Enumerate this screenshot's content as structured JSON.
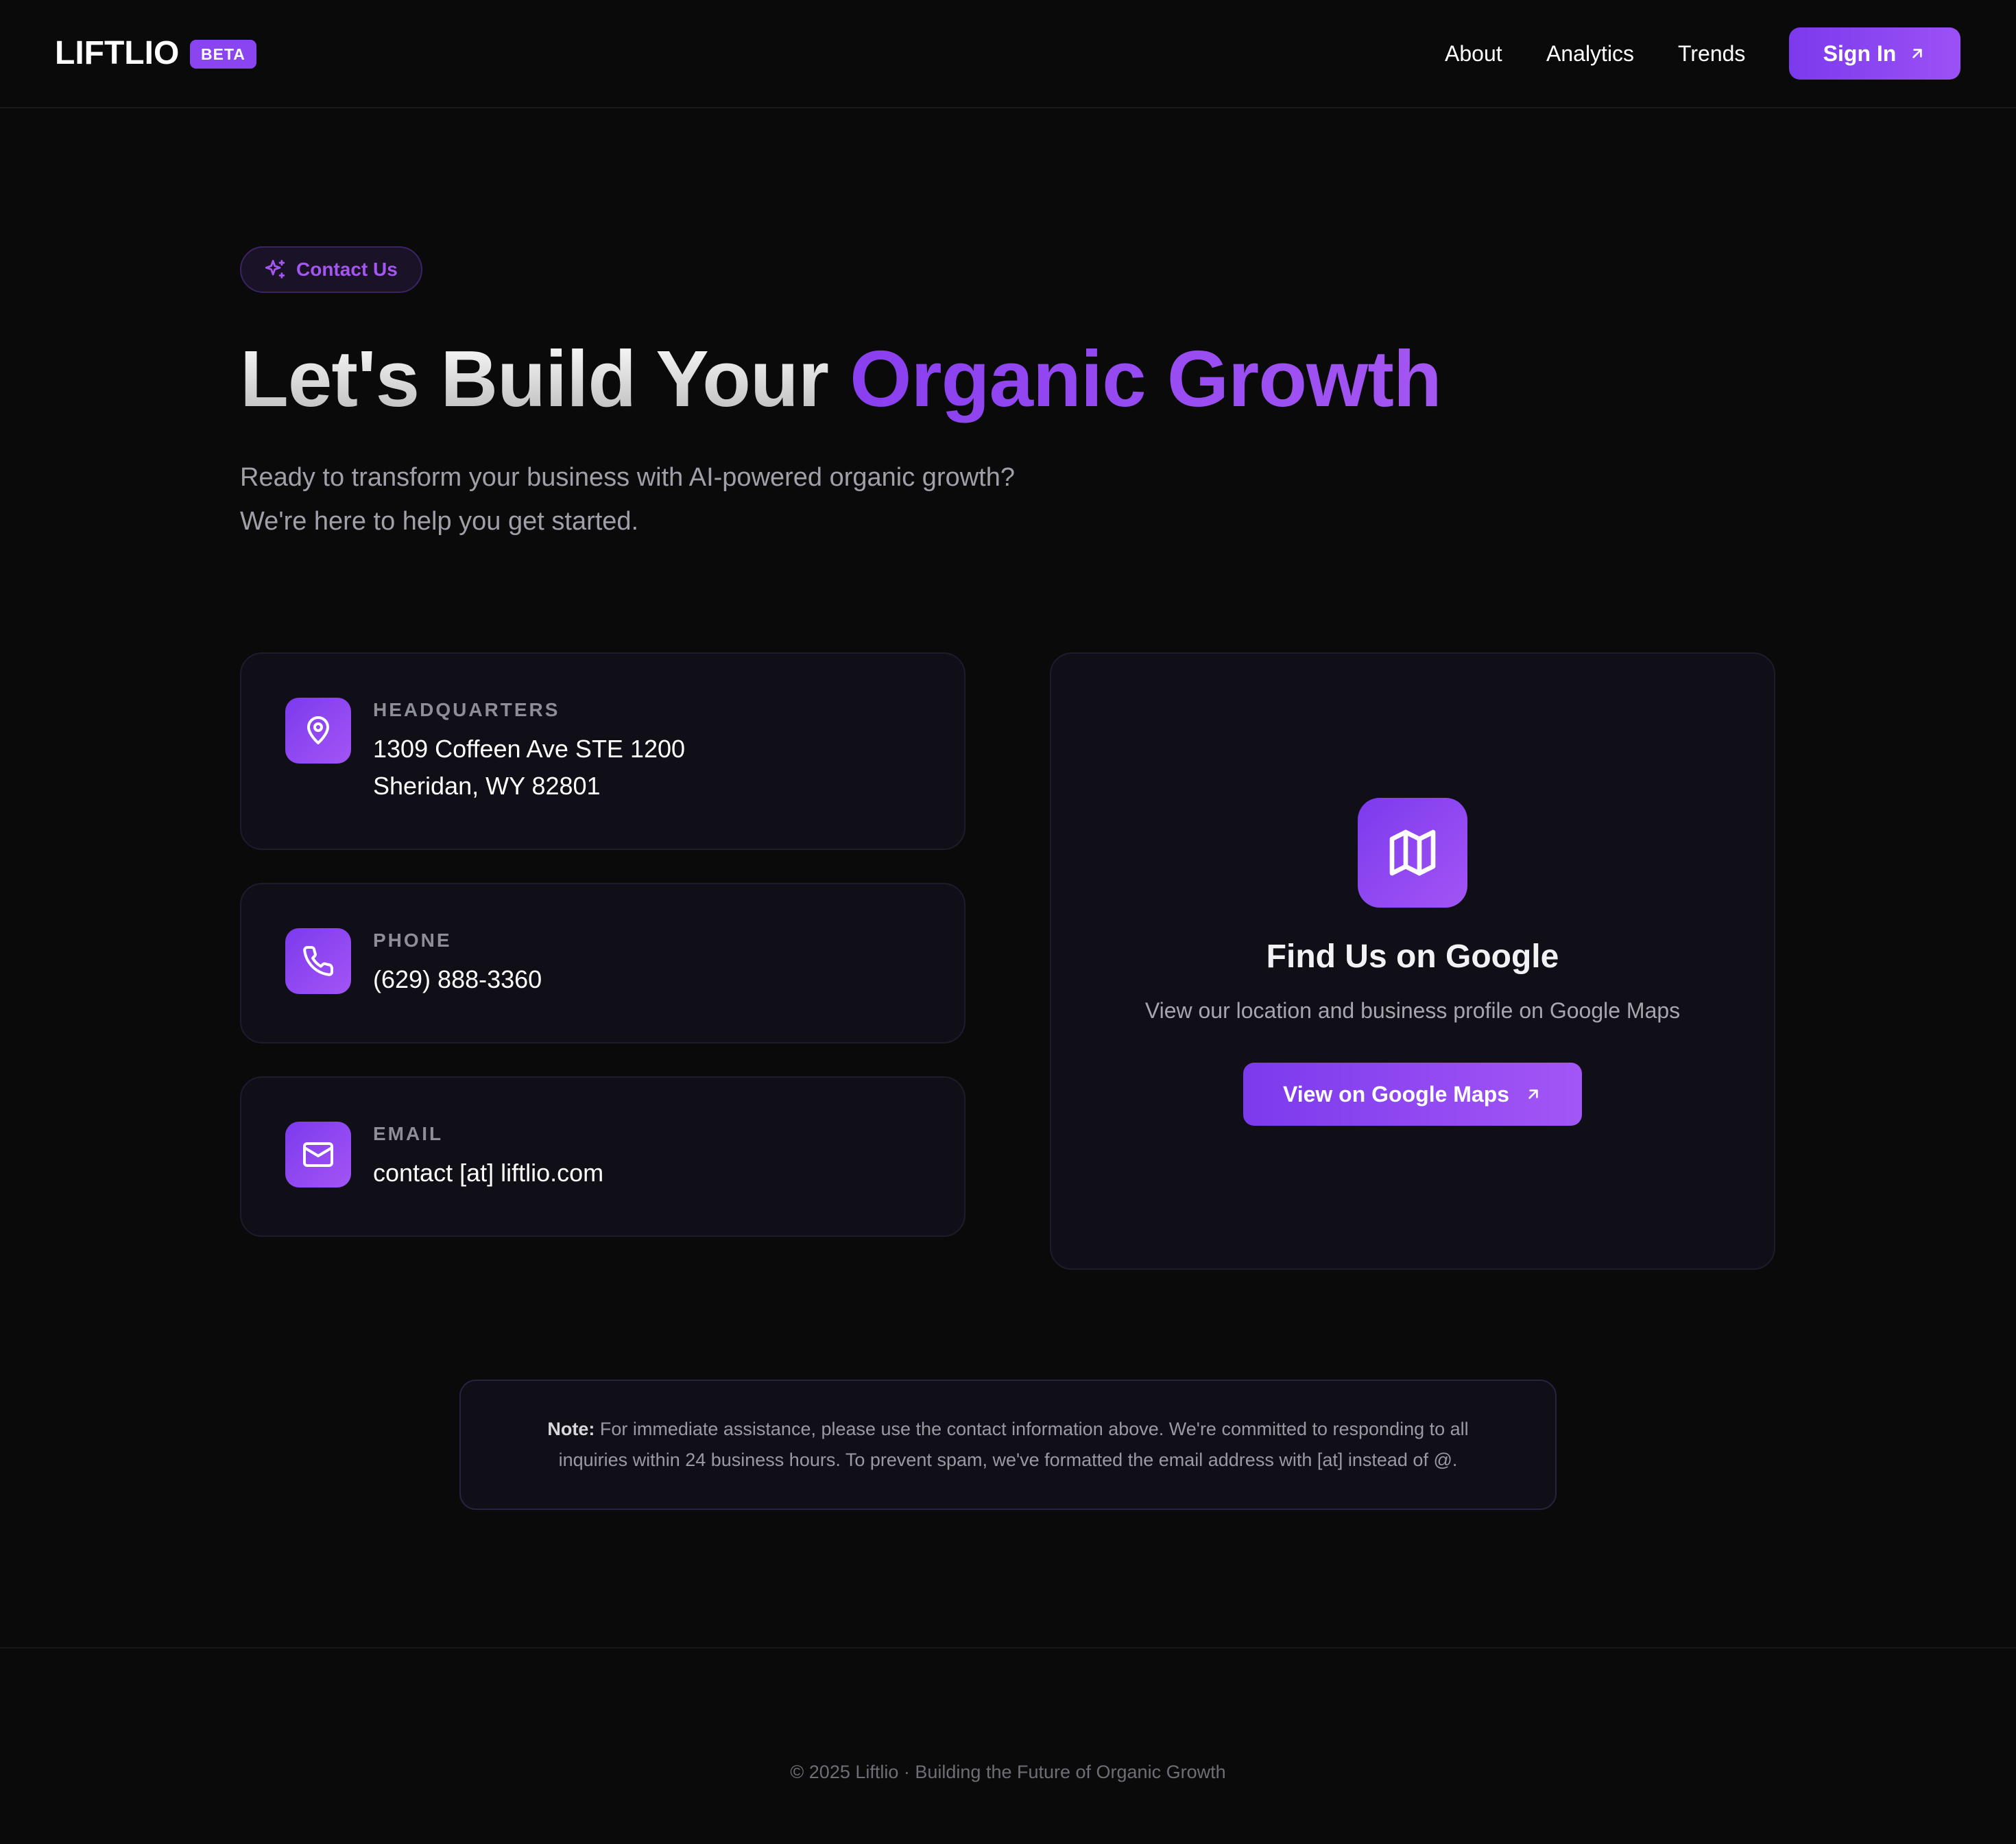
{
  "header": {
    "logo": "LIFTLIO",
    "badge": "BETA",
    "nav": [
      "About",
      "Analytics",
      "Trends"
    ],
    "signin_label": "Sign In"
  },
  "hero": {
    "pill_label": "Contact Us",
    "title_part1": "Let's Build Your ",
    "title_part2": "Organic Growth",
    "subtitle_line1": "Ready to transform your business with AI-powered organic growth?",
    "subtitle_line2": "We're here to help you get started."
  },
  "contact": {
    "headquarters": {
      "label": "HEADQUARTERS",
      "line1": "1309 Coffeen Ave STE 1200",
      "line2": "Sheridan, WY 82801"
    },
    "phone": {
      "label": "PHONE",
      "value": "(629) 888-3360"
    },
    "email": {
      "label": "EMAIL",
      "value": "contact [at] liftlio.com"
    }
  },
  "map_card": {
    "title": "Find Us on Google",
    "subtitle": "View our location and business profile on Google Maps",
    "button_label": "View on Google Maps"
  },
  "note": {
    "prefix": "Note:",
    "text": " For immediate assistance, please use the contact information above. We're committed to responding to all inquiries within 24 business hours. To prevent spam, we've formatted the email address with [at] instead of @."
  },
  "footer": {
    "text": "© 2025 Liftlio · Building the Future of Organic Growth"
  },
  "colors": {
    "background": "#0a0a0b",
    "accent": "#8b45f0",
    "card": "#100e16"
  }
}
